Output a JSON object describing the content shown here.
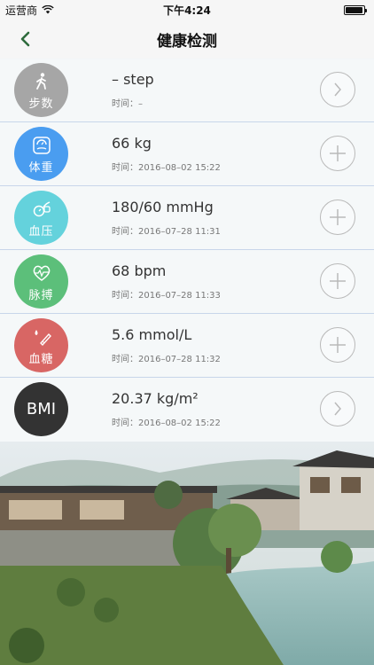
{
  "status_bar": {
    "carrier": "运营商",
    "time": "下午4:24",
    "battery_level": 0.95
  },
  "nav": {
    "title": "健康检测",
    "back_icon": "chevron-left-icon"
  },
  "colors": {
    "gray": "#a6a6a6",
    "blue": "#4a9df0",
    "cyan": "#64d2dc",
    "green": "#5cbf7a",
    "red": "#d86664",
    "dark": "#333333"
  },
  "items": [
    {
      "label": "步数",
      "value": "– step",
      "time": "时间：–",
      "icon": "walking-person-icon",
      "action": "arrow",
      "color": "#a6a6a6"
    },
    {
      "label": "体重",
      "value": "66 kg",
      "time": "时间：2016–08–02 15:22",
      "icon": "scale-icon",
      "action": "plus",
      "color": "#4a9df0"
    },
    {
      "label": "血压",
      "value": "180/60 mmHg",
      "time": "时间：2016–07–28 11:31",
      "icon": "blood-pressure-cuff-icon",
      "action": "plus",
      "color": "#64d2dc"
    },
    {
      "label": "脉搏",
      "value": "68 bpm",
      "time": "时间：2016–07–28 11:33",
      "icon": "heart-pulse-icon",
      "action": "plus",
      "color": "#5cbf7a"
    },
    {
      "label": "血糖",
      "value": "5.6 mmol/L",
      "time": "时间：2016–07–28 11:32",
      "icon": "glucose-meter-icon",
      "action": "plus",
      "color": "#d86664"
    },
    {
      "label": "BMI",
      "value": "20.37 kg/m²",
      "time": "时间：2016–08–02 15:22",
      "icon": "",
      "action": "arrow",
      "color": "#333333"
    }
  ]
}
